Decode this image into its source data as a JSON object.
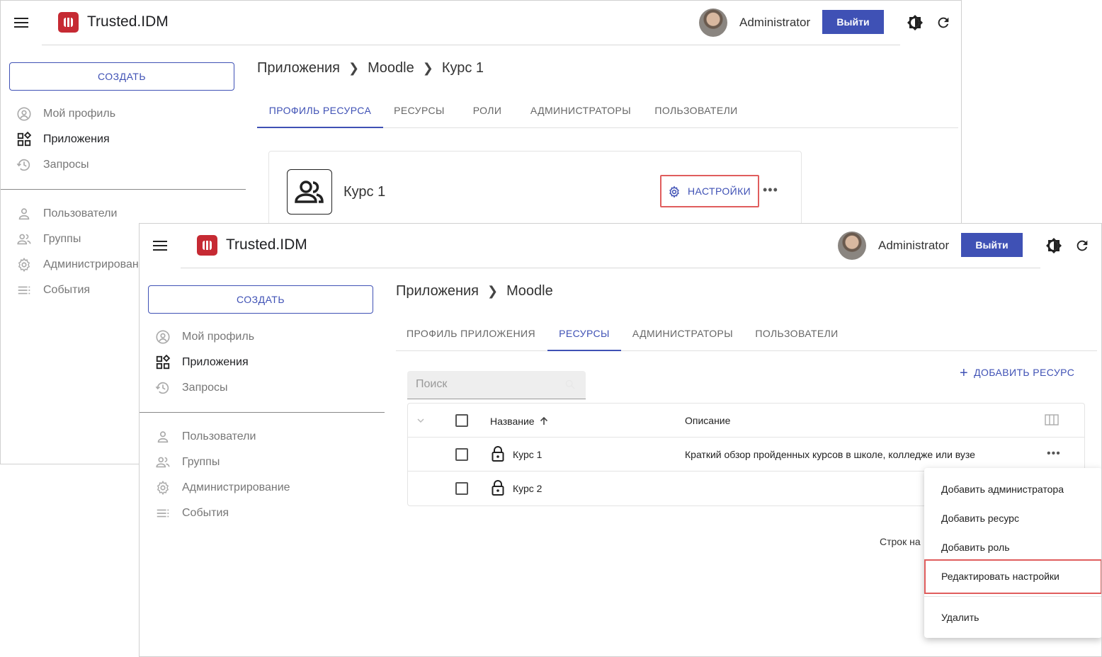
{
  "app": {
    "brand": "Trusted.IDM",
    "username": "Administrator",
    "logout_label": "Выйти",
    "create_label": "СОЗДАТЬ",
    "accent_color": "#3f51b5",
    "logo_color": "#c62a33"
  },
  "nav": {
    "my_profile": "Мой профиль",
    "applications": "Приложения",
    "requests": "Запросы",
    "users": "Пользователи",
    "groups": "Группы",
    "administration": "Администрирование",
    "events": "События"
  },
  "back_window": {
    "admin_partial": "Администрирован",
    "breadcrumb": [
      "Приложения",
      "Moodle",
      "Курс 1"
    ],
    "tabs": [
      "ПРОФИЛЬ РЕСУРСА",
      "РЕСУРСЫ",
      "РОЛИ",
      "АДМИНИСТРАТОРЫ",
      "ПОЛЬЗОВАТЕЛИ"
    ],
    "active_tab": "ПРОФИЛЬ РЕСУРСА",
    "card": {
      "title": "Курс 1",
      "settings_label": "НАСТРОЙКИ",
      "more_label": "•••"
    }
  },
  "front_window": {
    "breadcrumb": [
      "Приложения",
      "Moodle"
    ],
    "tabs": [
      "ПРОФИЛЬ ПРИЛОЖЕНИЯ",
      "РЕСУРСЫ",
      "АДМИНИСТРАТОРЫ",
      "ПОЛЬЗОВАТЕЛИ"
    ],
    "active_tab": "РЕСУРСЫ",
    "search_placeholder": "Поиск",
    "add_resource_label": "ДОБАВИТЬ РЕСУРС",
    "table": {
      "headers": [
        "Название",
        "Описание"
      ],
      "rows": [
        {
          "name": "Курс 1",
          "description": "Краткий обзор пройденных курсов в школе, колледже или вузе"
        },
        {
          "name": "Курс 2",
          "description": ""
        }
      ],
      "row_more_label": "•••"
    },
    "rows_per_page_label": "Строк на",
    "context_menu": [
      "Добавить администратора",
      "Добавить ресурс",
      "Добавить роль",
      "Редактировать настройки",
      "Удалить"
    ],
    "highlighted_item": "Редактировать настройки"
  }
}
